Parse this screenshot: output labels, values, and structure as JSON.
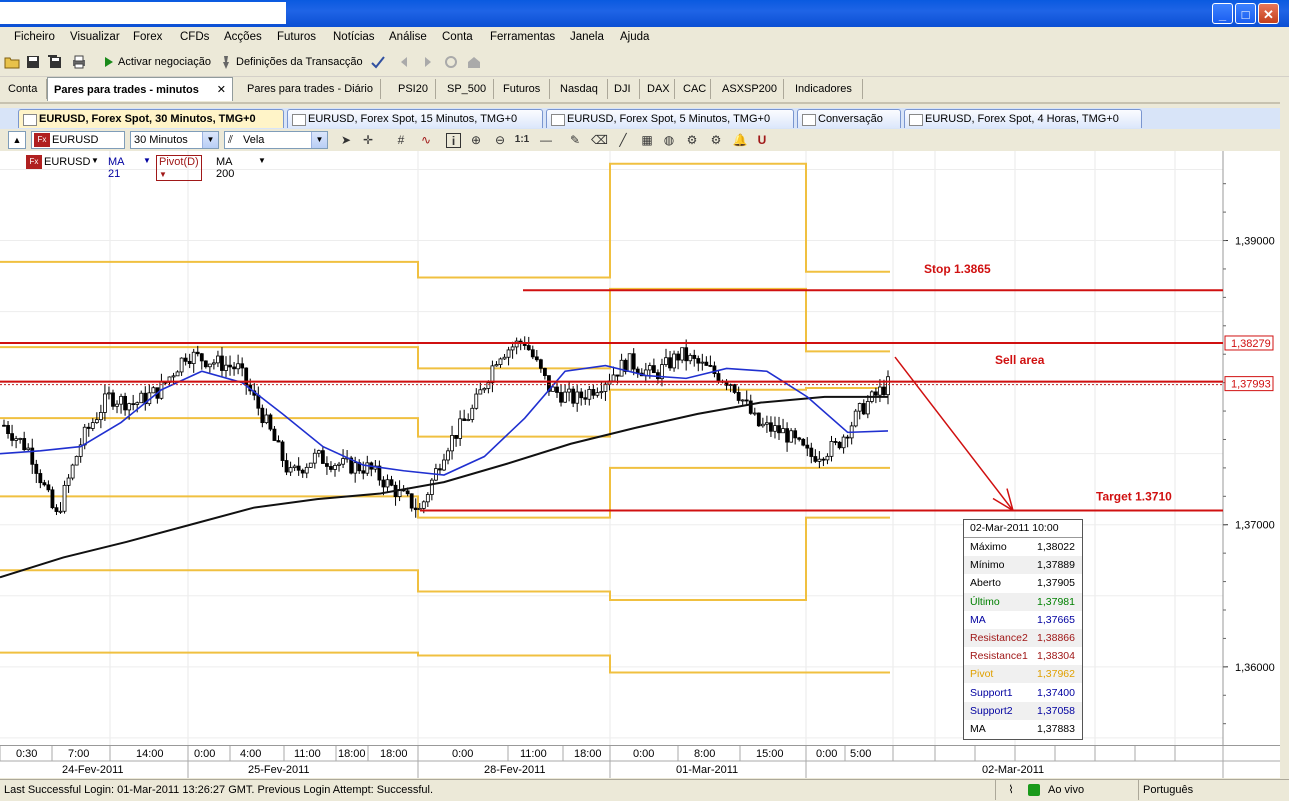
{
  "window": {
    "buttons": [
      "_",
      "□",
      "✕"
    ]
  },
  "menu": [
    "Ficheiro",
    "Visualizar",
    "Forex",
    "CFDs",
    "Acções",
    "Futuros",
    "Notícias",
    "Análise",
    "Conta",
    "Ferramentas",
    "Janela",
    "Ajuda"
  ],
  "toolbar": {
    "activate_label": "Activar negociação",
    "settings_label": "Definições da Transacção"
  },
  "tabs": [
    "Conta",
    "Pares para trades - minutos",
    "Pares para trades - Diário",
    "PSI20",
    "SP_500",
    "Futuros",
    "Nasdaq",
    "DJI",
    "DAX",
    "CAC",
    "ASXSP200",
    "Indicadores"
  ],
  "chart_tabs": [
    "EURUSD, Forex Spot, 30 Minutos, TMG+0",
    "EURUSD, Forex Spot, 15 Minutos, TMG+0",
    "EURUSD, Forex Spot, 5 Minutos, TMG+0",
    "Conversação",
    "EURUSD, Forex Spot, 4 Horas, TMG+0"
  ],
  "chart_toolbar": {
    "symbol": "EURUSD",
    "timeframe": "30 Minutos",
    "chart_type": "Vela",
    "zoom_label": "1:1"
  },
  "legend": {
    "symbol": "EURUSD",
    "ma21": "MA 21",
    "pivot": "Pivot(D)",
    "ma200": "MA 200"
  },
  "annotations": {
    "stop": "Stop 1.3865",
    "sell": "Sell area",
    "target": "Target 1.3710"
  },
  "price_labels": {
    "upper": "1,38279",
    "current": "1,37993"
  },
  "info": {
    "title": "02-Mar-2011 10:00",
    "rows": [
      {
        "k": "Máximo",
        "v": "1,38022",
        "color": "#000000"
      },
      {
        "k": "Mínimo",
        "v": "1,37889",
        "color": "#000000"
      },
      {
        "k": "Aberto",
        "v": "1,37905",
        "color": "#000000"
      },
      {
        "k": "Último",
        "v": "1,37981",
        "color": "#008000"
      },
      {
        "k": "MA",
        "v": "1,37665",
        "color": "#0000a0"
      },
      {
        "k": "Resistance2",
        "v": "1,38866",
        "color": "#a01818"
      },
      {
        "k": "Resistance1",
        "v": "1,38304",
        "color": "#a01818"
      },
      {
        "k": "Pivot",
        "v": "1,37962",
        "color": "#e0a000"
      },
      {
        "k": "Support1",
        "v": "1,37400",
        "color": "#0000a0"
      },
      {
        "k": "Support2",
        "v": "1,37058",
        "color": "#0000a0"
      },
      {
        "k": "MA",
        "v": "1,37883",
        "color": "#000000"
      }
    ]
  },
  "status": {
    "login": "Last Successful Login: 01-Mar-2011 13:26:27 GMT. Previous Login Attempt: Successful.",
    "live": "Ao vivo",
    "language": "Português"
  },
  "chart_data": {
    "type": "candlestick",
    "y_ticks": [
      "1,39000",
      "1,37000",
      "1,36000"
    ],
    "y_tick_values": [
      1.39,
      1.37,
      1.36
    ],
    "ylim": [
      1.3545,
      1.3963
    ],
    "x_time_ticks": [
      "0:30",
      "7:00",
      "14:00",
      "0:00",
      "4:00",
      "11:00",
      "18:00",
      "18:00",
      "0:00",
      "11:00",
      "18:00",
      "0:00",
      "8:00",
      "15:00",
      "0:00",
      "5:00"
    ],
    "x_date_ticks": [
      "24-Fev-2011",
      "25-Fev-2011",
      "28-Fev-2011",
      "01-Mar-2011",
      "02-Mar-2011"
    ],
    "horizontal_lines": [
      1.3865,
      1.38279,
      1.37993,
      1.371
    ],
    "pivot_levels": {
      "Resistance2": [
        1.3885,
        1.3885,
        1.3874,
        1.3954,
        1.3878
      ],
      "Resistance1": [
        1.3825,
        1.3825,
        1.381,
        1.3866,
        1.3822
      ],
      "Pivot": [
        1.3775,
        1.3775,
        1.3762,
        1.3795,
        1.37962
      ],
      "Support1": [
        1.372,
        1.372,
        1.3705,
        1.374,
        1.374
      ],
      "Support2": [
        1.3668,
        1.3668,
        1.3653,
        1.3647,
        1.3705
      ],
      "Support3": [
        1.361,
        1.361,
        1.3608,
        1.3596,
        1.3596
      ]
    },
    "ma21": [
      1.375,
      1.3752,
      1.3755,
      1.3772,
      1.3795,
      1.3808,
      1.38,
      1.3778,
      1.3755,
      1.3742,
      1.3738,
      1.3735,
      1.3748,
      1.3775,
      1.3808,
      1.3812,
      1.3805,
      1.3803,
      1.381,
      1.3808,
      1.379,
      1.3765,
      1.3766
    ],
    "ma200": [
      1.3663,
      1.3677,
      1.3688,
      1.37,
      1.3712,
      1.3718,
      1.3722,
      1.373,
      1.3743,
      1.3757,
      1.3768,
      1.3778,
      1.3786,
      1.379,
      1.379
    ],
    "close_series": [
      1.377,
      1.3752,
      1.3705,
      1.376,
      1.379,
      1.3785,
      1.3795,
      1.382,
      1.3815,
      1.381,
      1.3775,
      1.3735,
      1.3748,
      1.3742,
      1.374,
      1.3725,
      1.371,
      1.3755,
      1.378,
      1.382,
      1.383,
      1.3795,
      1.3788,
      1.38,
      1.3815,
      1.3805,
      1.382,
      1.381,
      1.38,
      1.377,
      1.3765,
      1.3748,
      1.3755,
      1.3782,
      1.3799
    ]
  }
}
